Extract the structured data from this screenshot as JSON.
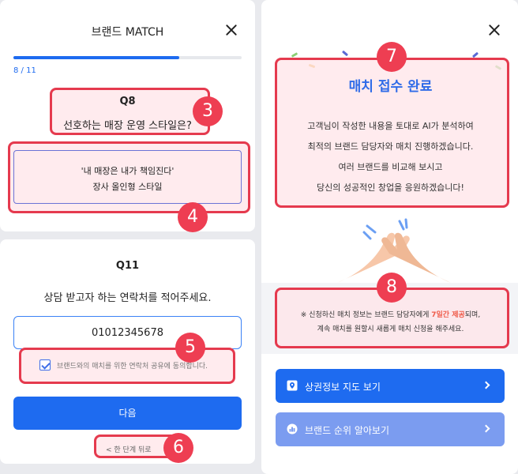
{
  "left_top": {
    "title": "브랜드 MATCH",
    "progress_text": "8 / 11",
    "progress_fraction": 0.727,
    "question_label": "Q8",
    "question_text": "선호하는 매장 운영 스타일은?",
    "answer_line1": "'내 매장은 내가 책임진다'",
    "answer_line2": "장사 올인형 스타일"
  },
  "left_bottom": {
    "question_label": "Q11",
    "question_text": "상담 받고자 하는 연락처를 적어주세요.",
    "phone_value": "01012345678",
    "consent_text": "브랜드와의 매치를 위한 연락처 공유에 동의합니다.",
    "consent_checked": true,
    "next_label": "다음",
    "back_label": "< 한 단계 뒤로"
  },
  "right": {
    "title": "매치 접수 완료",
    "body_lines": [
      "고객님이 작성한 내용을 토대로 AI가 분석하여",
      "최적의 브랜드 담당자와 매치 진행하겠습니다.",
      "여러 브랜드를 비교해 보시고",
      "당신의 성공적인 창업을 응원하겠습니다!"
    ],
    "notice_prefix": "※ 신청하신 매치 정보는 브랜드 담당자에게 ",
    "notice_highlight": "7일간 제공",
    "notice_suffix": "되며,",
    "notice_line2": "계속 매치를 원할시 새롭게 매치 신청을 해주세요.",
    "cta_map": "상권정보 지도 보기",
    "cta_rank": "브랜드 순위 알아보기"
  },
  "badges": {
    "b3": "3",
    "b4": "4",
    "b5": "5",
    "b6": "6",
    "b7": "7",
    "b8": "8"
  },
  "colors": {
    "primary": "#1e6bf0",
    "highlight_border": "#e53a4e",
    "badge": "#ee3e52",
    "accent_text": "#ef5b4a",
    "cta_light": "#7b9cf0"
  },
  "icons": [
    "close-icon",
    "checkbox-check-icon",
    "map-pin-icon",
    "rank-icon",
    "chevron-right-icon",
    "high-five-illustration"
  ]
}
